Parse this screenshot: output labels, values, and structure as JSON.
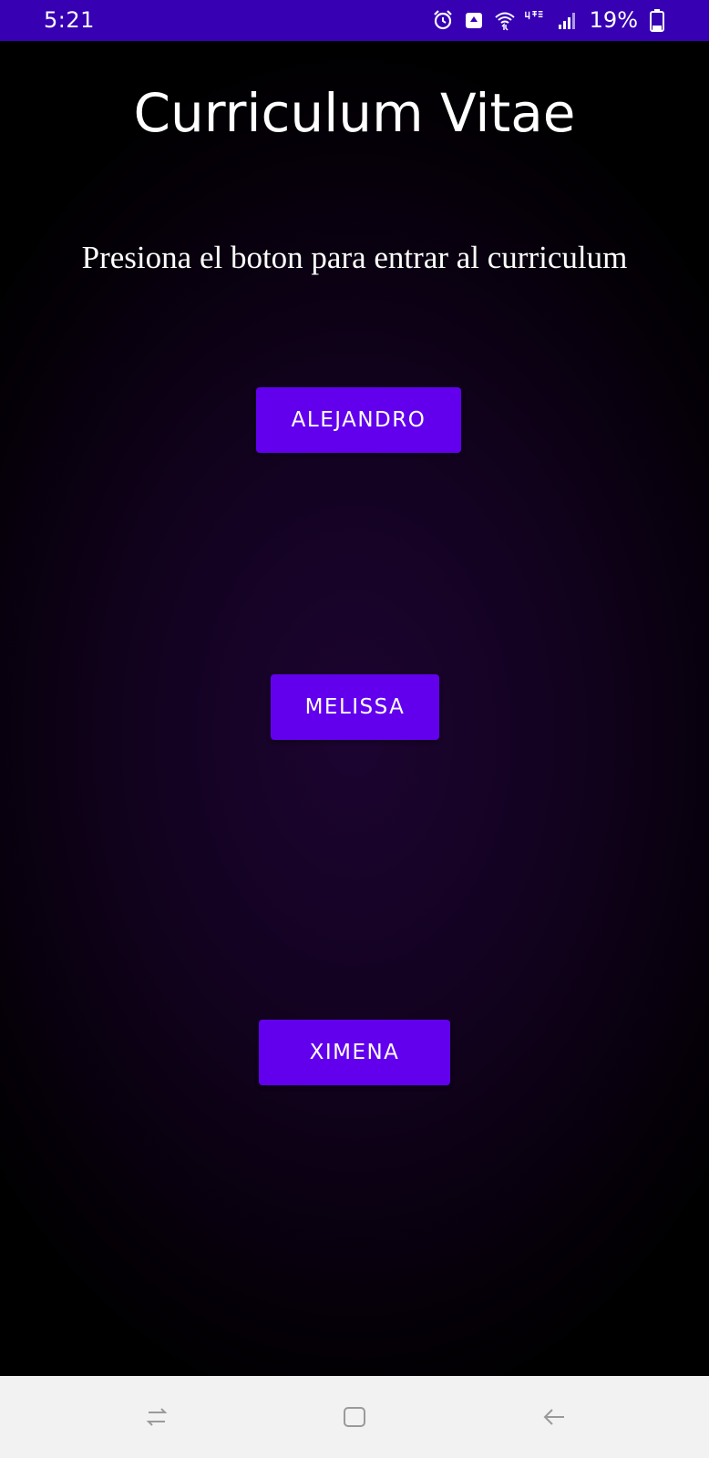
{
  "status_bar": {
    "time": "5:21",
    "battery_percent": "19%",
    "icons": [
      "alarm-icon",
      "recycle-notification-icon",
      "wifi-icon",
      "lte-icon",
      "signal-icon",
      "battery-icon"
    ],
    "background": "#3700b3"
  },
  "main": {
    "title": "Curriculum Vitae",
    "subtitle": "Presiona el boton para entrar al curriculum",
    "buttons": [
      {
        "label": "ALEJANDRO"
      },
      {
        "label": "MELISSA"
      },
      {
        "label": "XIMENA"
      }
    ],
    "button_color": "#6200ee"
  },
  "nav_bar": {
    "items": [
      "recents-icon",
      "home-icon",
      "back-icon"
    ]
  }
}
